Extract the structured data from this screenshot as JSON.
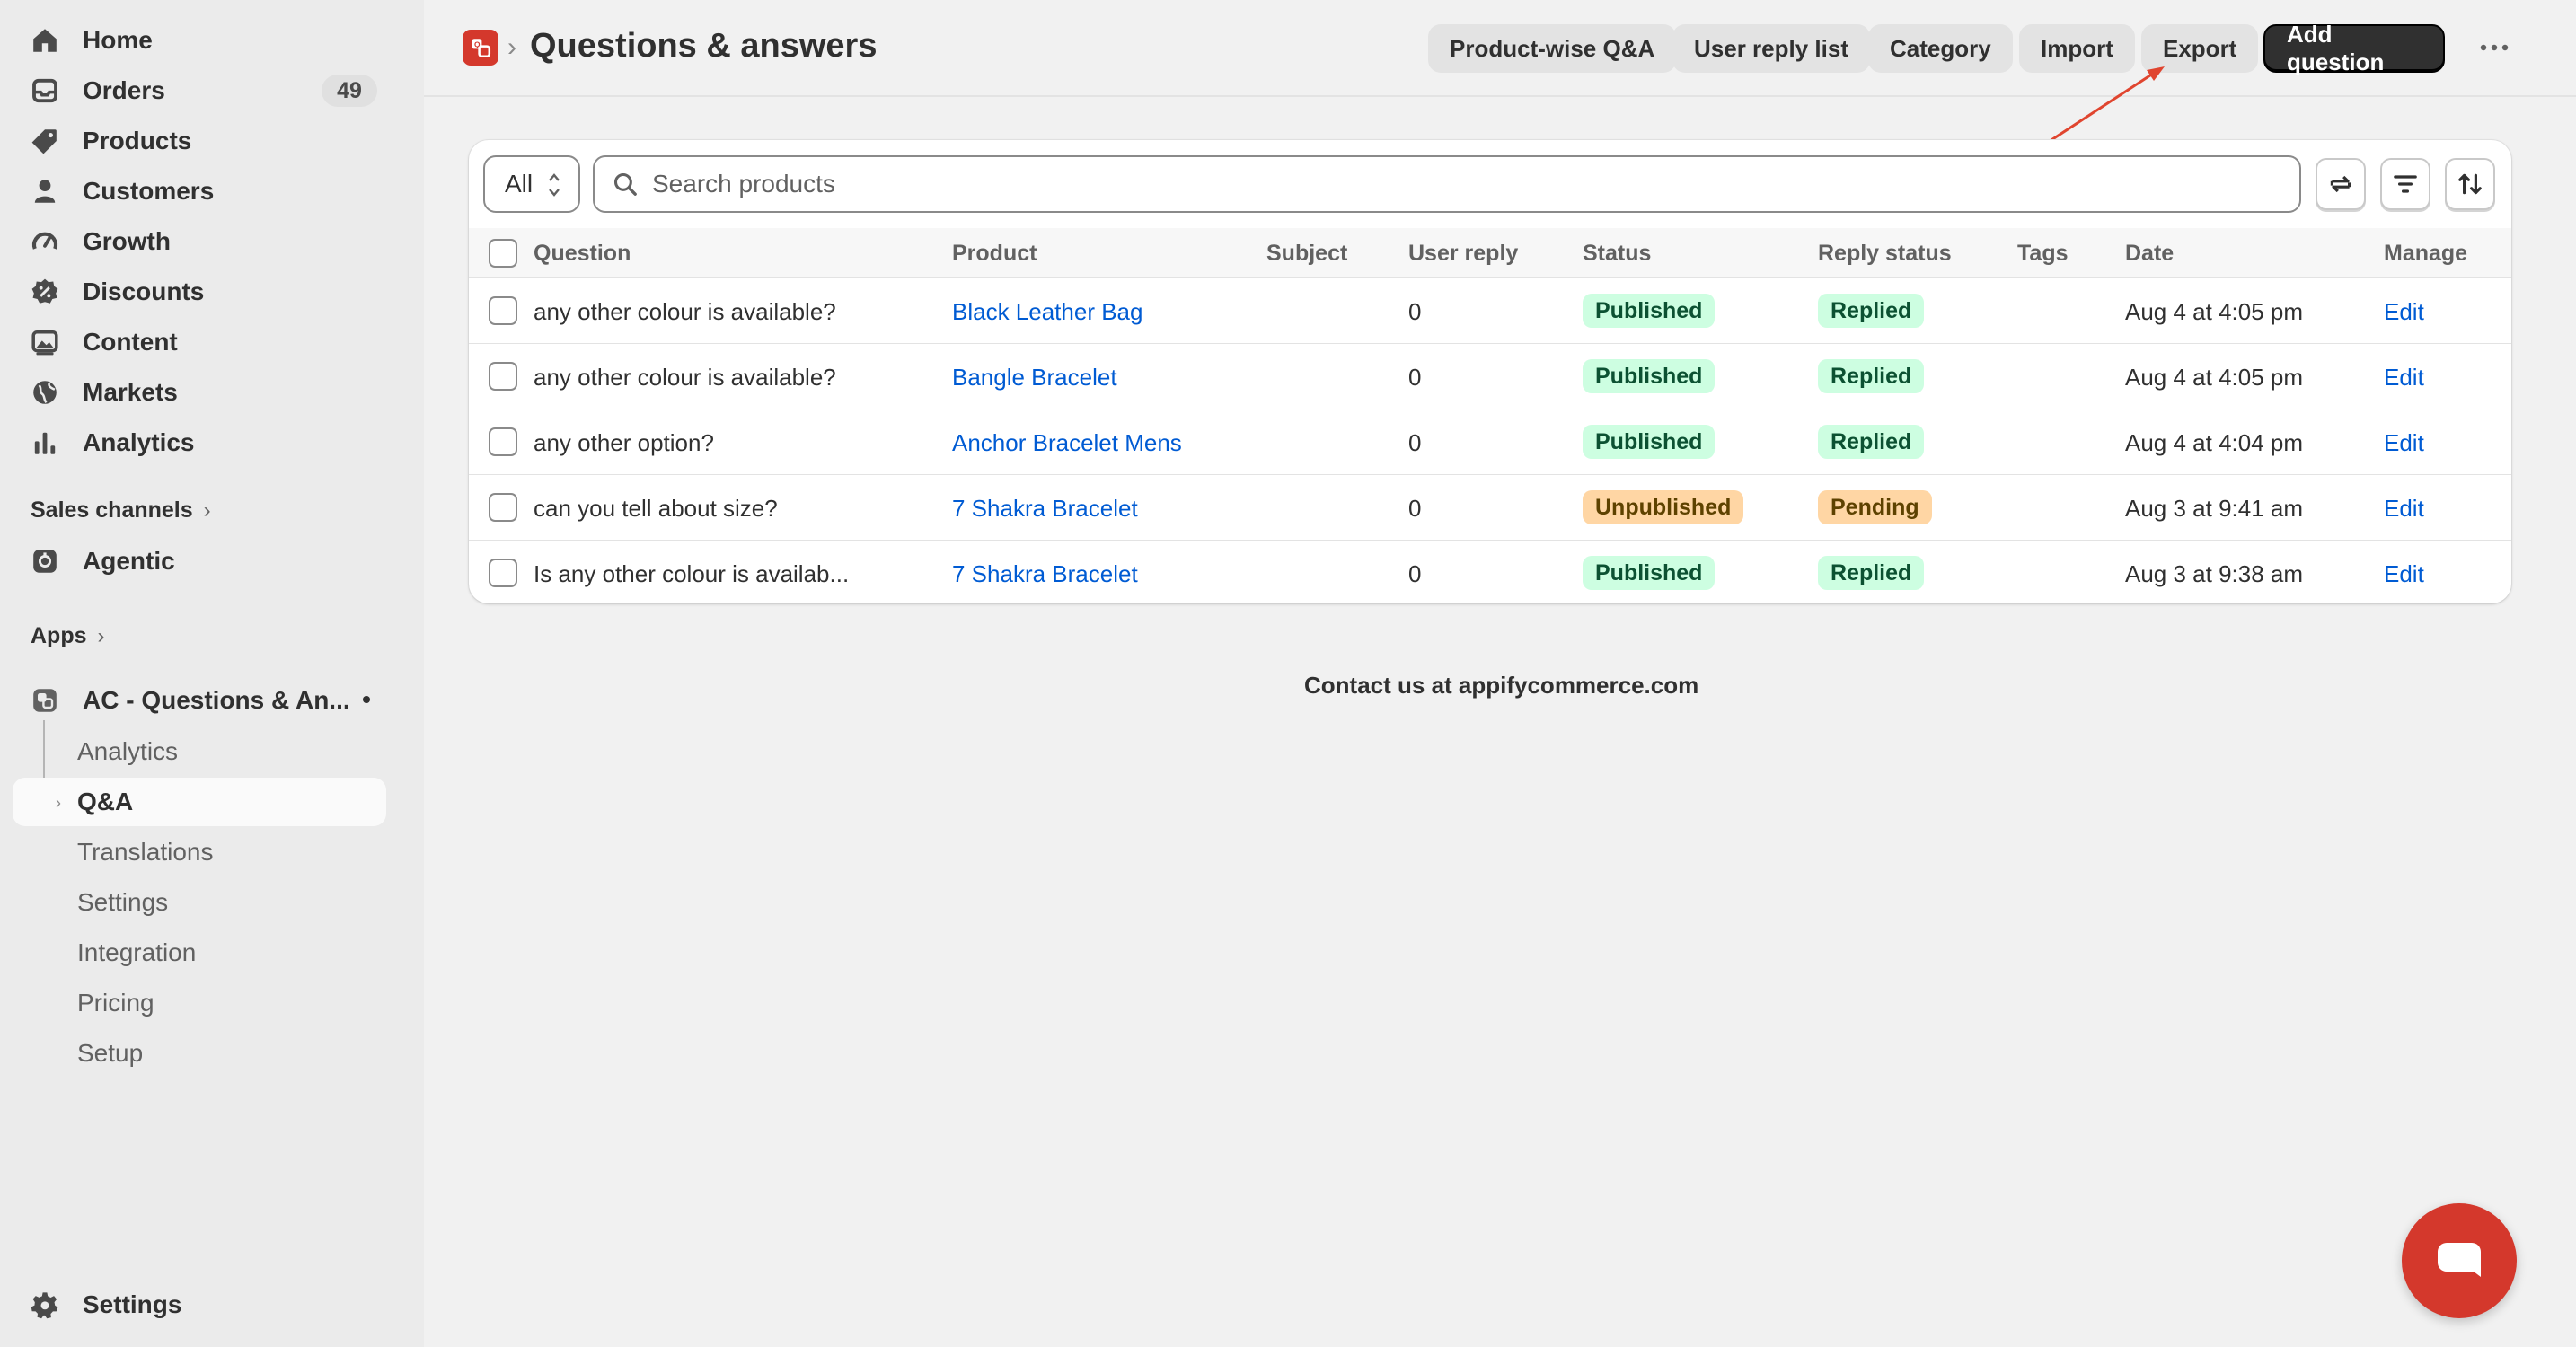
{
  "sidebar": {
    "items": [
      {
        "label": "Home",
        "icon": "home-icon"
      },
      {
        "label": "Orders",
        "icon": "inbox-icon",
        "badge": "49"
      },
      {
        "label": "Products",
        "icon": "tag-icon"
      },
      {
        "label": "Customers",
        "icon": "person-icon"
      },
      {
        "label": "Growth",
        "icon": "gauge-icon"
      },
      {
        "label": "Discounts",
        "icon": "discount-icon"
      },
      {
        "label": "Content",
        "icon": "image-icon"
      },
      {
        "label": "Markets",
        "icon": "globe-icon"
      },
      {
        "label": "Analytics",
        "icon": "bar-chart-icon"
      }
    ],
    "sales_channels_label": "Sales channels",
    "agentic_label": "Agentic",
    "apps_label": "Apps",
    "app_name": "AC - Questions & An...",
    "app_sub_items": [
      "Analytics",
      "Q&A",
      "Translations",
      "Settings",
      "Integration",
      "Pricing",
      "Setup"
    ],
    "active_sub_item": "Q&A",
    "settings_label": "Settings"
  },
  "header": {
    "title": "Questions & answers",
    "buttons": {
      "product_wise": "Product-wise Q&A",
      "user_reply_list": "User reply list",
      "category": "Category",
      "import": "Import",
      "export": "Export",
      "add_question": "Add question"
    }
  },
  "filters": {
    "select_value": "All",
    "search_placeholder": "Search products"
  },
  "table": {
    "columns": [
      "Question",
      "Product",
      "Subject",
      "User reply",
      "Status",
      "Reply status",
      "Tags",
      "Date",
      "Manage"
    ],
    "rows": [
      {
        "question": "any other colour is available?",
        "product": "Black Leather Bag",
        "subject": "",
        "user_reply": "0",
        "status": "Published",
        "reply_status": "Replied",
        "tags": "",
        "date": "Aug 4 at 4:05 pm",
        "manage": "Edit"
      },
      {
        "question": "any other colour is available?",
        "product": "Bangle Bracelet",
        "subject": "",
        "user_reply": "0",
        "status": "Published",
        "reply_status": "Replied",
        "tags": "",
        "date": "Aug 4 at 4:05 pm",
        "manage": "Edit"
      },
      {
        "question": "any other option?",
        "product": "Anchor Bracelet Mens",
        "subject": "",
        "user_reply": "0",
        "status": "Published",
        "reply_status": "Replied",
        "tags": "",
        "date": "Aug 4 at 4:04 pm",
        "manage": "Edit"
      },
      {
        "question": "can you tell about size?",
        "product": "7 Shakra Bracelet",
        "subject": "",
        "user_reply": "0",
        "status": "Unpublished",
        "reply_status": "Pending",
        "tags": "",
        "date": "Aug 3 at 9:41 am",
        "manage": "Edit"
      },
      {
        "question": "Is any other colour is availab...",
        "product": "7 Shakra Bracelet",
        "subject": "",
        "user_reply": "0",
        "status": "Published",
        "reply_status": "Replied",
        "tags": "",
        "date": "Aug 3 at 9:38 am",
        "manage": "Edit"
      }
    ]
  },
  "footer": {
    "contact": "Contact us at appifycommerce.com"
  },
  "colors": {
    "brand_red": "#d4382c",
    "link_blue": "#005bd3",
    "published_bg": "#cdfee1",
    "pending_bg": "#ffd6a4",
    "primary_button": "#303030"
  }
}
